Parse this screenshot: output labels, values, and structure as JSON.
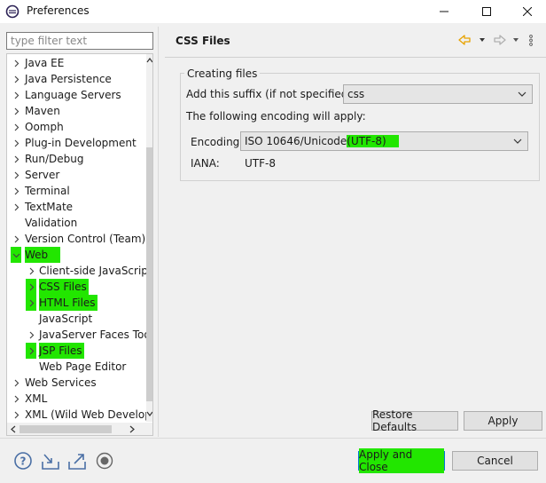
{
  "window": {
    "title": "Preferences",
    "min_label": "—",
    "max_label": "☐",
    "close_label": "✕"
  },
  "filter": {
    "placeholder": "type filter text",
    "value": ""
  },
  "tree": {
    "items": [
      {
        "label": "Java EE",
        "expanded": false,
        "highlighted": false
      },
      {
        "label": "Java Persistence",
        "expanded": false,
        "highlighted": false
      },
      {
        "label": "Language Servers",
        "expanded": false,
        "highlighted": false
      },
      {
        "label": "Maven",
        "expanded": false,
        "highlighted": false
      },
      {
        "label": "Oomph",
        "expanded": false,
        "highlighted": false
      },
      {
        "label": "Plug-in Development",
        "expanded": false,
        "highlighted": false
      },
      {
        "label": "Run/Debug",
        "expanded": false,
        "highlighted": false
      },
      {
        "label": "Server",
        "expanded": false,
        "highlighted": false
      },
      {
        "label": "Terminal",
        "expanded": false,
        "highlighted": false
      },
      {
        "label": "TextMate",
        "expanded": false,
        "highlighted": false
      },
      {
        "label": "Validation",
        "expanded": null,
        "highlighted": false
      },
      {
        "label": "Version Control (Team)",
        "expanded": false,
        "highlighted": false
      },
      {
        "label": "Web",
        "expanded": true,
        "highlighted": true
      },
      {
        "label": "Client-side JavaScript",
        "expanded": false,
        "highlighted": false
      },
      {
        "label": "CSS Files",
        "expanded": false,
        "highlighted": true
      },
      {
        "label": "HTML Files",
        "expanded": false,
        "highlighted": true
      },
      {
        "label": "JavaScript",
        "expanded": null,
        "highlighted": false
      },
      {
        "label": "JavaServer Faces Tools",
        "expanded": false,
        "highlighted": false
      },
      {
        "label": "JSP Files",
        "expanded": false,
        "highlighted": true
      },
      {
        "label": "Web Page Editor",
        "expanded": null,
        "highlighted": false
      },
      {
        "label": "Web Services",
        "expanded": false,
        "highlighted": false
      },
      {
        "label": "XML",
        "expanded": false,
        "highlighted": false
      },
      {
        "label": "XML (Wild Web Developer)",
        "expanded": false,
        "highlighted": false
      }
    ]
  },
  "page": {
    "title": "CSS Files",
    "group_title": "Creating files",
    "suffix_label": "Add this suffix (if not specified):",
    "suffix_value": "css",
    "encoding_note": "The following encoding will apply:",
    "encoding_label": "Encoding:",
    "encoding_value_main": "ISO 10646/Unicode",
    "encoding_value_hl": "(UTF-8)",
    "iana_label": "IANA:",
    "iana_value": "UTF-8"
  },
  "buttons": {
    "restore_defaults": "Restore Defaults",
    "apply": "Apply",
    "apply_close": "Apply and Close",
    "cancel": "Cancel"
  },
  "colors": {
    "highlight": "#22e600",
    "default_button_border": "#0078d7",
    "nav_back_arrow": "#e8a200"
  },
  "icons": [
    "eclipse-app-icon",
    "help-icon",
    "import-icon",
    "export-icon",
    "record-icon",
    "back-arrow-icon",
    "forward-arrow-icon",
    "view-menu-icon"
  ]
}
